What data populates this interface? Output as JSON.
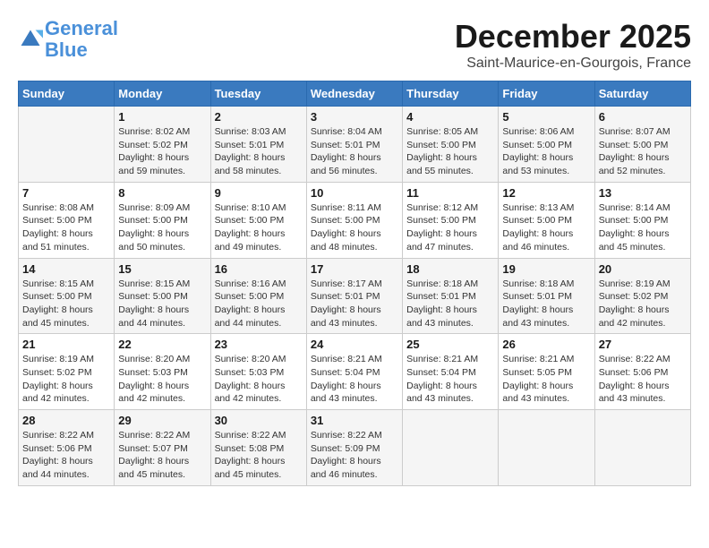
{
  "header": {
    "logo_line1": "General",
    "logo_line2": "Blue",
    "month": "December 2025",
    "location": "Saint-Maurice-en-Gourgois, France"
  },
  "weekdays": [
    "Sunday",
    "Monday",
    "Tuesday",
    "Wednesday",
    "Thursday",
    "Friday",
    "Saturday"
  ],
  "weeks": [
    [
      {
        "day": "",
        "sunrise": "",
        "sunset": "",
        "daylight": ""
      },
      {
        "day": "1",
        "sunrise": "Sunrise: 8:02 AM",
        "sunset": "Sunset: 5:02 PM",
        "daylight": "Daylight: 8 hours and 59 minutes."
      },
      {
        "day": "2",
        "sunrise": "Sunrise: 8:03 AM",
        "sunset": "Sunset: 5:01 PM",
        "daylight": "Daylight: 8 hours and 58 minutes."
      },
      {
        "day": "3",
        "sunrise": "Sunrise: 8:04 AM",
        "sunset": "Sunset: 5:01 PM",
        "daylight": "Daylight: 8 hours and 56 minutes."
      },
      {
        "day": "4",
        "sunrise": "Sunrise: 8:05 AM",
        "sunset": "Sunset: 5:00 PM",
        "daylight": "Daylight: 8 hours and 55 minutes."
      },
      {
        "day": "5",
        "sunrise": "Sunrise: 8:06 AM",
        "sunset": "Sunset: 5:00 PM",
        "daylight": "Daylight: 8 hours and 53 minutes."
      },
      {
        "day": "6",
        "sunrise": "Sunrise: 8:07 AM",
        "sunset": "Sunset: 5:00 PM",
        "daylight": "Daylight: 8 hours and 52 minutes."
      }
    ],
    [
      {
        "day": "7",
        "sunrise": "Sunrise: 8:08 AM",
        "sunset": "Sunset: 5:00 PM",
        "daylight": "Daylight: 8 hours and 51 minutes."
      },
      {
        "day": "8",
        "sunrise": "Sunrise: 8:09 AM",
        "sunset": "Sunset: 5:00 PM",
        "daylight": "Daylight: 8 hours and 50 minutes."
      },
      {
        "day": "9",
        "sunrise": "Sunrise: 8:10 AM",
        "sunset": "Sunset: 5:00 PM",
        "daylight": "Daylight: 8 hours and 49 minutes."
      },
      {
        "day": "10",
        "sunrise": "Sunrise: 8:11 AM",
        "sunset": "Sunset: 5:00 PM",
        "daylight": "Daylight: 8 hours and 48 minutes."
      },
      {
        "day": "11",
        "sunrise": "Sunrise: 8:12 AM",
        "sunset": "Sunset: 5:00 PM",
        "daylight": "Daylight: 8 hours and 47 minutes."
      },
      {
        "day": "12",
        "sunrise": "Sunrise: 8:13 AM",
        "sunset": "Sunset: 5:00 PM",
        "daylight": "Daylight: 8 hours and 46 minutes."
      },
      {
        "day": "13",
        "sunrise": "Sunrise: 8:14 AM",
        "sunset": "Sunset: 5:00 PM",
        "daylight": "Daylight: 8 hours and 45 minutes."
      }
    ],
    [
      {
        "day": "14",
        "sunrise": "Sunrise: 8:15 AM",
        "sunset": "Sunset: 5:00 PM",
        "daylight": "Daylight: 8 hours and 45 minutes."
      },
      {
        "day": "15",
        "sunrise": "Sunrise: 8:15 AM",
        "sunset": "Sunset: 5:00 PM",
        "daylight": "Daylight: 8 hours and 44 minutes."
      },
      {
        "day": "16",
        "sunrise": "Sunrise: 8:16 AM",
        "sunset": "Sunset: 5:00 PM",
        "daylight": "Daylight: 8 hours and 44 minutes."
      },
      {
        "day": "17",
        "sunrise": "Sunrise: 8:17 AM",
        "sunset": "Sunset: 5:01 PM",
        "daylight": "Daylight: 8 hours and 43 minutes."
      },
      {
        "day": "18",
        "sunrise": "Sunrise: 8:18 AM",
        "sunset": "Sunset: 5:01 PM",
        "daylight": "Daylight: 8 hours and 43 minutes."
      },
      {
        "day": "19",
        "sunrise": "Sunrise: 8:18 AM",
        "sunset": "Sunset: 5:01 PM",
        "daylight": "Daylight: 8 hours and 43 minutes."
      },
      {
        "day": "20",
        "sunrise": "Sunrise: 8:19 AM",
        "sunset": "Sunset: 5:02 PM",
        "daylight": "Daylight: 8 hours and 42 minutes."
      }
    ],
    [
      {
        "day": "21",
        "sunrise": "Sunrise: 8:19 AM",
        "sunset": "Sunset: 5:02 PM",
        "daylight": "Daylight: 8 hours and 42 minutes."
      },
      {
        "day": "22",
        "sunrise": "Sunrise: 8:20 AM",
        "sunset": "Sunset: 5:03 PM",
        "daylight": "Daylight: 8 hours and 42 minutes."
      },
      {
        "day": "23",
        "sunrise": "Sunrise: 8:20 AM",
        "sunset": "Sunset: 5:03 PM",
        "daylight": "Daylight: 8 hours and 42 minutes."
      },
      {
        "day": "24",
        "sunrise": "Sunrise: 8:21 AM",
        "sunset": "Sunset: 5:04 PM",
        "daylight": "Daylight: 8 hours and 43 minutes."
      },
      {
        "day": "25",
        "sunrise": "Sunrise: 8:21 AM",
        "sunset": "Sunset: 5:04 PM",
        "daylight": "Daylight: 8 hours and 43 minutes."
      },
      {
        "day": "26",
        "sunrise": "Sunrise: 8:21 AM",
        "sunset": "Sunset: 5:05 PM",
        "daylight": "Daylight: 8 hours and 43 minutes."
      },
      {
        "day": "27",
        "sunrise": "Sunrise: 8:22 AM",
        "sunset": "Sunset: 5:06 PM",
        "daylight": "Daylight: 8 hours and 43 minutes."
      }
    ],
    [
      {
        "day": "28",
        "sunrise": "Sunrise: 8:22 AM",
        "sunset": "Sunset: 5:06 PM",
        "daylight": "Daylight: 8 hours and 44 minutes."
      },
      {
        "day": "29",
        "sunrise": "Sunrise: 8:22 AM",
        "sunset": "Sunset: 5:07 PM",
        "daylight": "Daylight: 8 hours and 45 minutes."
      },
      {
        "day": "30",
        "sunrise": "Sunrise: 8:22 AM",
        "sunset": "Sunset: 5:08 PM",
        "daylight": "Daylight: 8 hours and 45 minutes."
      },
      {
        "day": "31",
        "sunrise": "Sunrise: 8:22 AM",
        "sunset": "Sunset: 5:09 PM",
        "daylight": "Daylight: 8 hours and 46 minutes."
      },
      {
        "day": "",
        "sunrise": "",
        "sunset": "",
        "daylight": ""
      },
      {
        "day": "",
        "sunrise": "",
        "sunset": "",
        "daylight": ""
      },
      {
        "day": "",
        "sunrise": "",
        "sunset": "",
        "daylight": ""
      }
    ]
  ]
}
